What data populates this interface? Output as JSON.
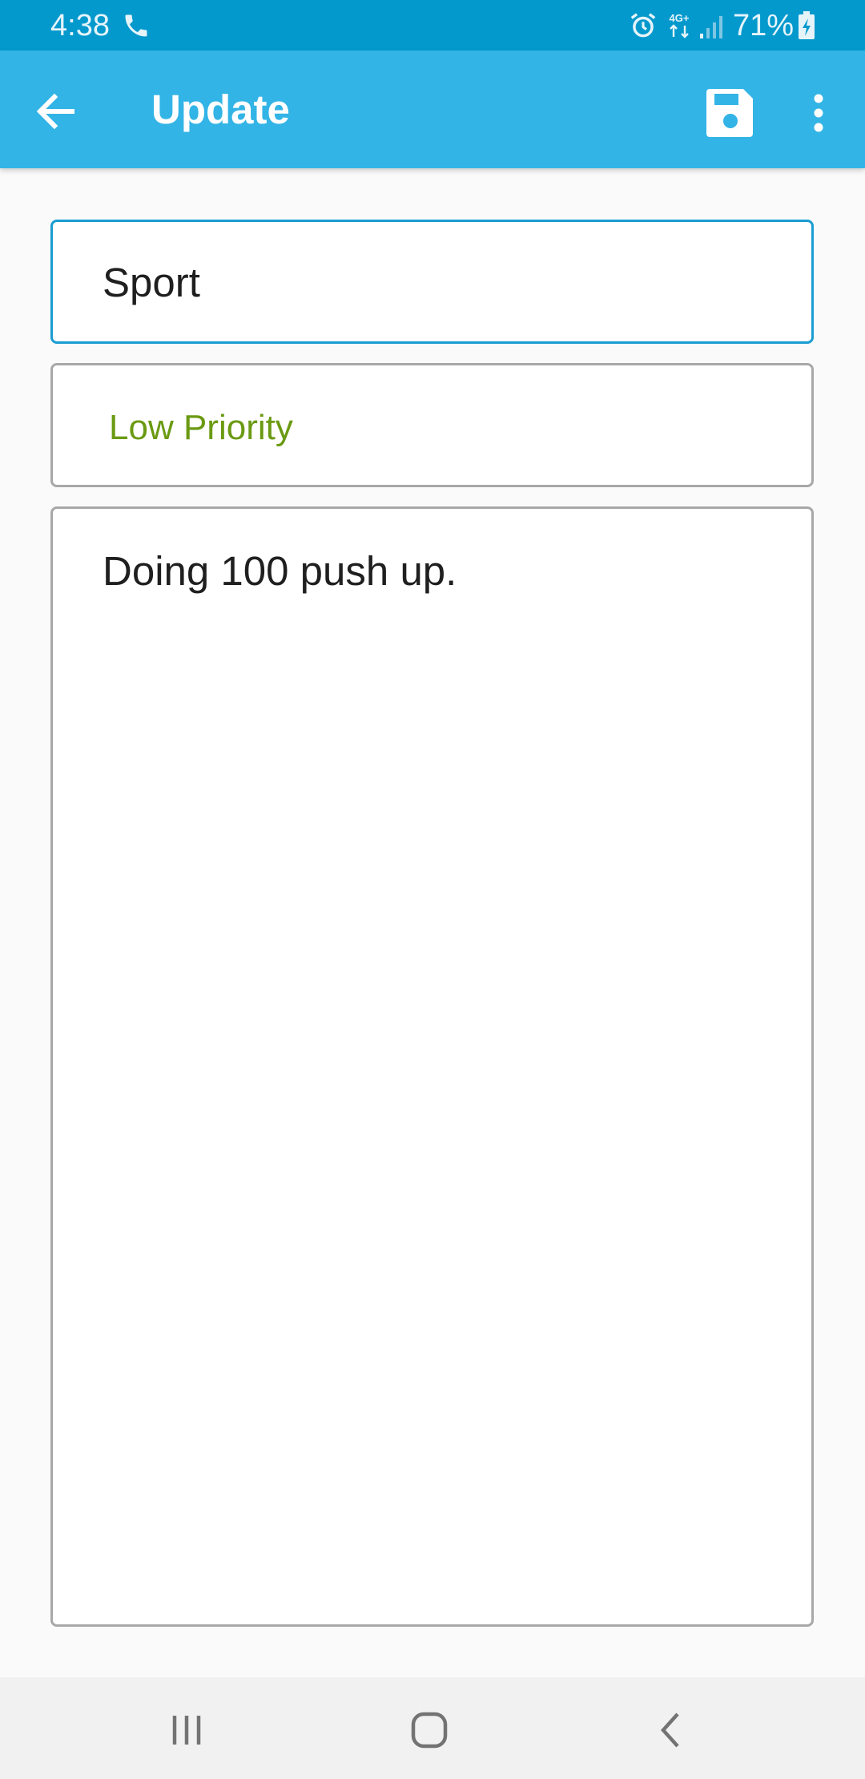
{
  "status_bar": {
    "time": "4:38",
    "battery": "71%",
    "network": "4G+",
    "icons": [
      "phone-icon",
      "alarm-icon",
      "network-4g-icon",
      "signal-icon",
      "battery-charging-icon"
    ]
  },
  "app_bar": {
    "title": "Update",
    "icons": [
      "back-arrow-icon",
      "save-icon",
      "more-vert-icon"
    ]
  },
  "form": {
    "title_value": "Sport",
    "priority_value": "Low Priority",
    "description_value": "Doing 100 push up."
  },
  "nav_bar": {
    "icons": [
      "recent-apps-icon",
      "home-icon",
      "back-icon"
    ]
  },
  "colors": {
    "status_bar": "#0399cd",
    "app_bar": "#33b4e6",
    "accent": "#1a9dd1",
    "priority_low": "#6a9a12"
  }
}
